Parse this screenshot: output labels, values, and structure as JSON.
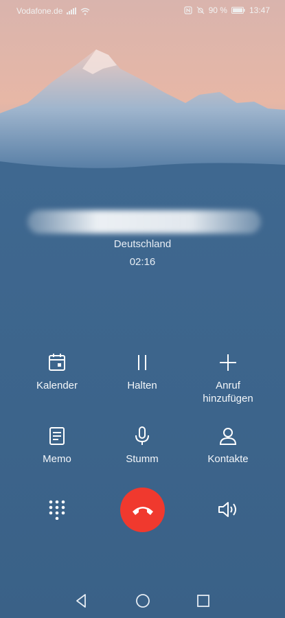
{
  "status": {
    "carrier": "Vodafone.de",
    "battery": "90 %",
    "time": "13:47"
  },
  "call": {
    "location": "Deutschland",
    "duration": "02:16"
  },
  "actions": {
    "calendar": "Kalender",
    "hold": "Halten",
    "add_call": "Anruf hinzufügen",
    "memo": "Memo",
    "mute": "Stumm",
    "contacts": "Kontakte"
  },
  "icons": {
    "dialpad": "dialpad-icon",
    "end_call": "end-call-icon",
    "speaker": "speaker-icon"
  },
  "colors": {
    "background": "#3a6187",
    "end_call": "#f0392e"
  }
}
